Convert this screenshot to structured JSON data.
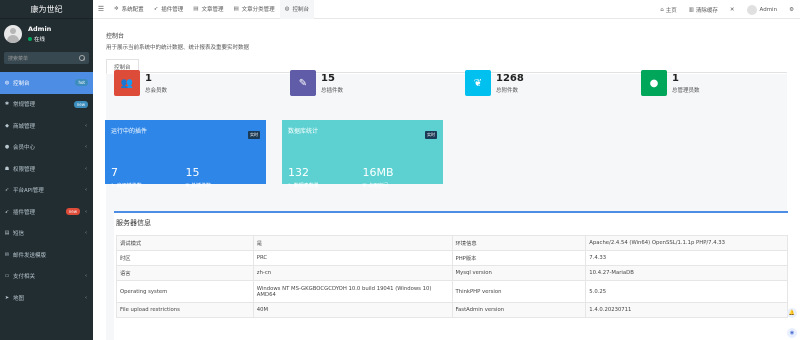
{
  "brand": "康为世纪",
  "user": {
    "name": "Admin",
    "status": "在线"
  },
  "search": {
    "placeholder": "搜索菜单"
  },
  "sidebar": {
    "items": [
      {
        "label": "控制台",
        "icon": "dashboard-icon",
        "glyph": "◍",
        "badge": "hot",
        "active": true
      },
      {
        "label": "常规管理",
        "icon": "cogs-icon",
        "glyph": "✱",
        "badge": "new"
      },
      {
        "label": "商城管理",
        "icon": "shield-icon",
        "glyph": "◆",
        "chevron": "‹"
      },
      {
        "label": "会员中心",
        "icon": "user-icon",
        "glyph": "●",
        "chevron": "‹"
      },
      {
        "label": "权限管理",
        "icon": "group-icon",
        "glyph": "☗",
        "chevron": "‹"
      },
      {
        "label": "平台API管理",
        "icon": "rocket-icon",
        "glyph": "➶",
        "chevron": "‹"
      },
      {
        "label": "插件管理",
        "icon": "plugin-icon",
        "glyph": "➹",
        "badge": "new",
        "chevron": "‹"
      },
      {
        "label": "短信",
        "icon": "sms-icon",
        "glyph": "▤",
        "chevron": "‹"
      },
      {
        "label": "邮件发送模版",
        "icon": "mail-icon",
        "glyph": "✉"
      },
      {
        "label": "支付相关",
        "icon": "pay-icon",
        "glyph": "▭",
        "chevron": "‹"
      },
      {
        "label": "地图",
        "icon": "map-icon",
        "glyph": "➤",
        "chevron": "‹"
      }
    ]
  },
  "topbar": {
    "tabs": [
      {
        "label": "系统配置",
        "icon": "gear-icon",
        "glyph": "✲"
      },
      {
        "label": "插件管理",
        "icon": "rocket-icon",
        "glyph": "➶"
      },
      {
        "label": "文章管理",
        "icon": "file-icon",
        "glyph": "▤"
      },
      {
        "label": "文章分类管理",
        "icon": "file-icon",
        "glyph": "▤"
      },
      {
        "label": "控制台",
        "icon": "dashboard-icon",
        "glyph": "◍",
        "active": true
      }
    ],
    "right": {
      "home": "主页",
      "clear_cache": "清除缓存",
      "user": "Admin"
    }
  },
  "content": {
    "title": "控制台",
    "desc": "用于展示当前系统中的统计数据、统计报表及重要实时数据",
    "subtab": "控制台"
  },
  "stats": [
    {
      "num": "1",
      "label": "总会员数",
      "color": "#dd4b39",
      "icon": "users-icon",
      "glyph": "👥"
    },
    {
      "num": "15",
      "label": "总插件数",
      "color": "#605ca8",
      "icon": "magic-icon",
      "glyph": "✎"
    },
    {
      "num": "1268",
      "label": "总附件数",
      "color": "#00c0ef",
      "icon": "leaf-icon",
      "glyph": "❦"
    },
    {
      "num": "1",
      "label": "总管理员数",
      "color": "#00a65a",
      "icon": "user-icon",
      "glyph": "●"
    }
  ],
  "cards": [
    {
      "title": "运行中的插件",
      "tag": "实时",
      "color": "#2d86e8",
      "left": {
        "num": "7",
        "label": "启用插件数"
      },
      "right": {
        "num": "15",
        "label": "总插件数"
      }
    },
    {
      "title": "数据库统计",
      "tag": "实时",
      "color": "#5dd1d1",
      "left": {
        "num": "132",
        "label": "数据表数量"
      },
      "right": {
        "num": "16MB",
        "label": "占用空间"
      }
    }
  ],
  "server": {
    "title": "服务器信息",
    "rows": [
      [
        "调试模式",
        "是",
        "环境信息",
        "Apache/2.4.54 (Win64) OpenSSL/1.1.1p PHP/7.4.33"
      ],
      [
        "时区",
        "PRC",
        "PHP版本",
        "7.4.33"
      ],
      [
        "语言",
        "zh-cn",
        "Mysql version",
        "10.4.27-MariaDB"
      ],
      [
        "Operating system",
        "Windows NT MS-GKGBOCGCDYOH 10.0 build 19041 (Windows 10) AMD64",
        "ThinkPHP version",
        "5.0.25"
      ],
      [
        "File upload restrictions",
        "40M",
        "FastAdmin version",
        "1.4.0.20230711"
      ]
    ]
  }
}
